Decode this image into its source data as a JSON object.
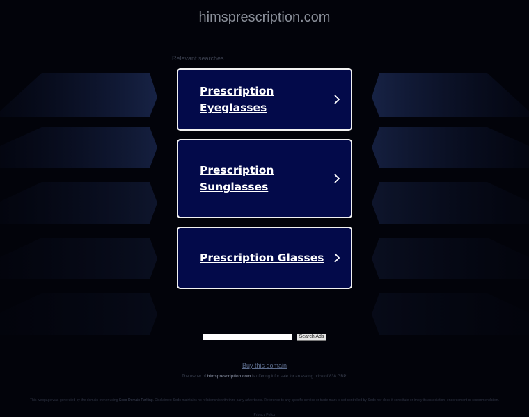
{
  "site": {
    "title": "himsprescription.com"
  },
  "related": {
    "heading": "Relevant searches",
    "items": [
      {
        "label": "Prescription Eyeglasses"
      },
      {
        "label": "Prescription Sunglasses"
      },
      {
        "label": "Prescription Glasses"
      }
    ]
  },
  "search": {
    "value": "",
    "button_label": "Search Ads"
  },
  "footer": {
    "buy_link": "Buy this domain",
    "owner_prefix": "The owner of ",
    "owner_domain": "himsprescription.com",
    "owner_suffix": " is offering it for sale for an asking price of 838 GBP!",
    "disclaimer_prefix": "This webpage was generated by the domain owner using ",
    "disclaimer_link": "Sedo Domain Parking",
    "disclaimer_suffix": ". Disclaimer: Sedo maintains no relationship with third party advertisers. Reference to any specific service or trade mark is not controlled by Sedo nor does it constitute or imply its association, endorsement or recommendation.",
    "privacy_link": "Privacy Policy"
  },
  "colors": {
    "background": "#02030a",
    "card_background": "#030a4a",
    "card_border": "#f2f2f2"
  },
  "icons": {
    "card_arrow": "chevron-right-icon"
  }
}
